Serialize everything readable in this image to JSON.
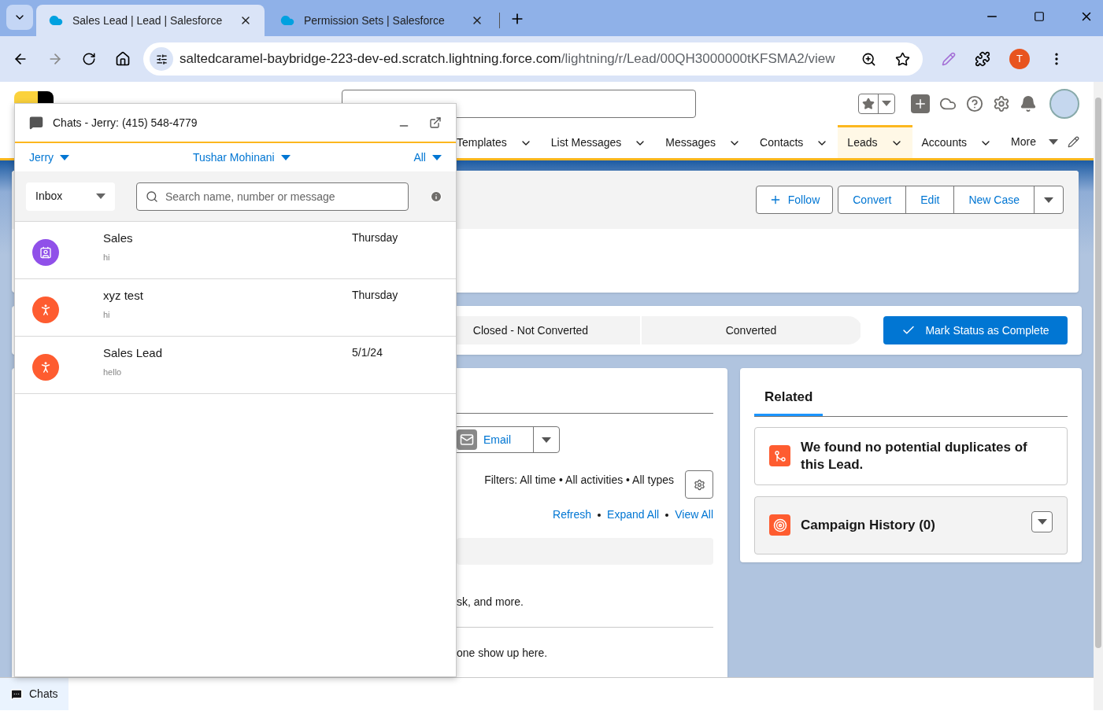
{
  "browser": {
    "tabs": [
      {
        "title": "Sales Lead | Lead | Salesforce",
        "selected": true
      },
      {
        "title": "Permission Sets | Salesforce",
        "selected": false
      }
    ],
    "url": {
      "host": "saltedcaramel-baybridge-223-dev-ed.scratch.lightning.force.com",
      "path": "/lightning/r/Lead/00QH3000000tKFSMA2/view"
    },
    "profile_initial": "T"
  },
  "nav": {
    "items": [
      {
        "label": "Templates",
        "selected": false
      },
      {
        "label": "List Messages",
        "selected": false
      },
      {
        "label": "Messages",
        "selected": false
      },
      {
        "label": "Contacts",
        "selected": false
      },
      {
        "label": "Leads",
        "selected": true
      },
      {
        "label": "Accounts",
        "selected": false
      }
    ],
    "more": "More"
  },
  "record": {
    "actions": [
      "Convert",
      "Edit",
      "New Case"
    ],
    "follow": "Follow"
  },
  "path": {
    "steps": [
      {
        "label": "Closed - Not Converted",
        "selected": false
      },
      {
        "label": "Converted",
        "selected": false
      }
    ],
    "complete_button": "Mark Status as Complete"
  },
  "activity": {
    "email_button": "Email",
    "filters": "Filters: All time • All activities • All types",
    "links": [
      "Refresh",
      "Expand All",
      "View All"
    ],
    "texts": [
      "sk, and more.",
      "one show up here."
    ]
  },
  "related": {
    "tab": "Related",
    "duplicates": "We found no potential duplicates of this Lead.",
    "campaign": "Campaign History (0)"
  },
  "chat": {
    "title": "Chats - Jerry: (415) 548-4779",
    "filters": [
      "Jerry",
      "Tushar Mohinani",
      "All"
    ],
    "folder": "Inbox",
    "search_placeholder": "Search name, number or message",
    "conversations": [
      {
        "kind": "contact",
        "name": "Sales",
        "preview": "hi",
        "time": "Thursday"
      },
      {
        "kind": "lead",
        "name": "xyz test",
        "preview": "hi",
        "time": "Thursday"
      },
      {
        "kind": "lead",
        "name": "Sales Lead",
        "preview": "hello",
        "time": "5/1/24"
      }
    ]
  },
  "utility": {
    "chats": "Chats"
  }
}
